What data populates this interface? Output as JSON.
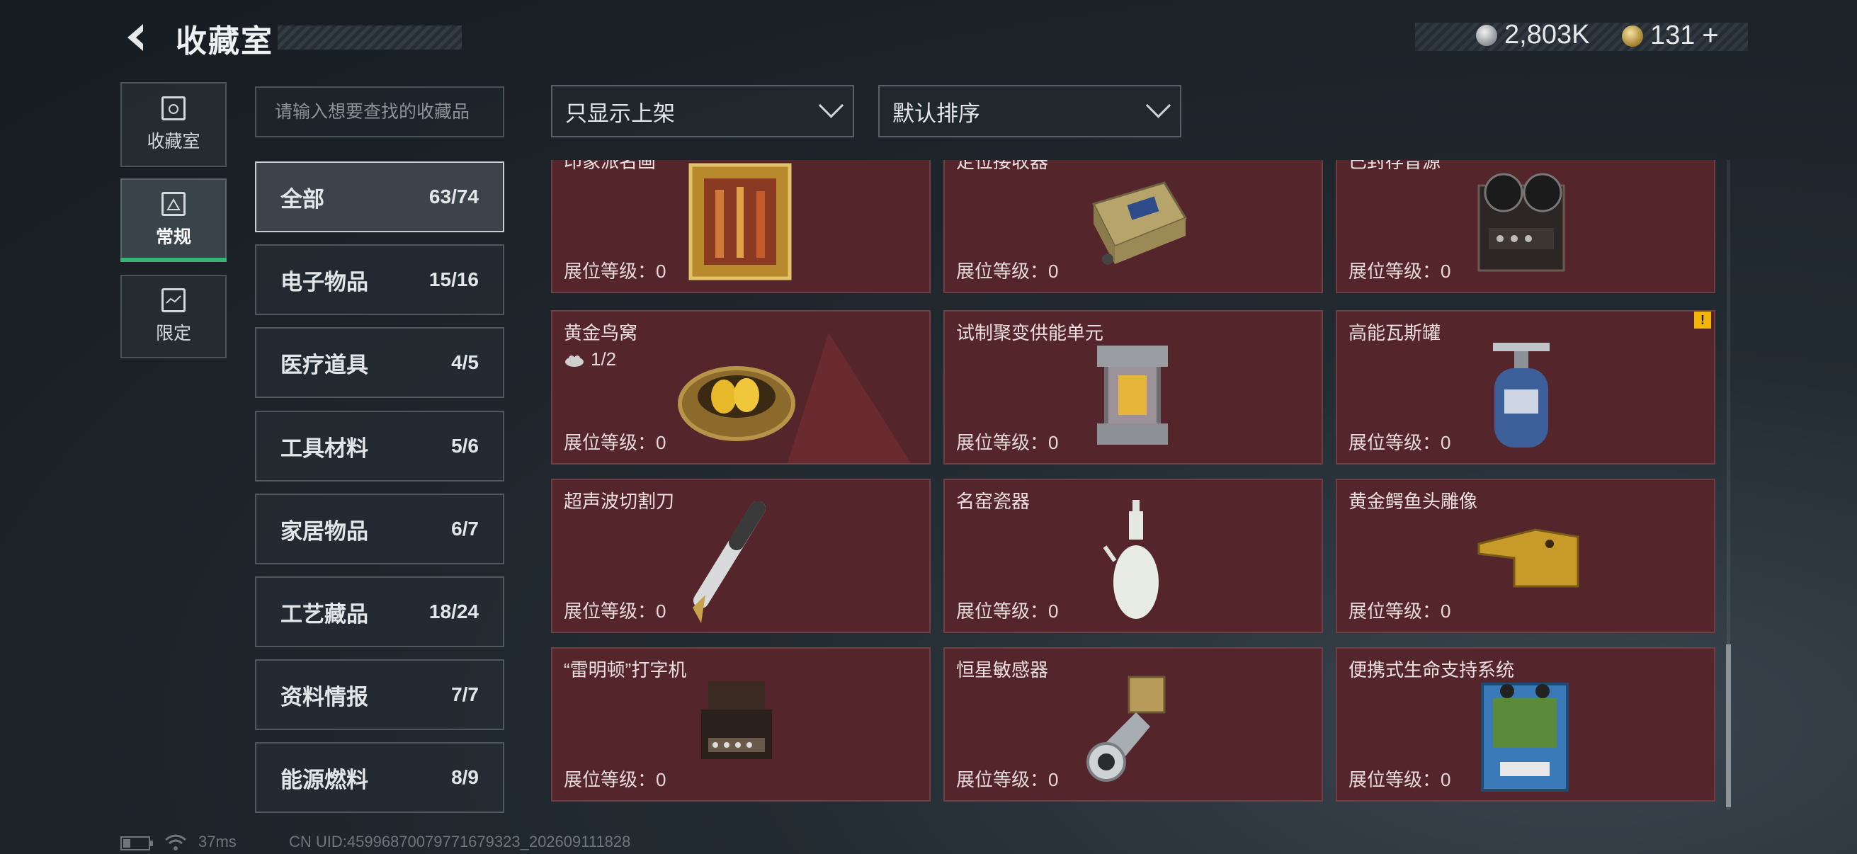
{
  "header": {
    "title": "收藏室"
  },
  "currency": {
    "silver": "2,803K",
    "gold": "131",
    "plus": "+"
  },
  "left_nav": [
    {
      "label": "收藏室",
      "icon": "trophy-icon"
    },
    {
      "label": "常规",
      "icon": "image-frame-icon",
      "active": true
    },
    {
      "label": "限定",
      "icon": "map-icon"
    }
  ],
  "search": {
    "placeholder": "请输入想要查找的收藏品"
  },
  "filters": {
    "display": "只显示上架",
    "sort": "默认排序"
  },
  "categories": [
    {
      "name": "全部",
      "count": "63/74",
      "active": true
    },
    {
      "name": "电子物品",
      "count": "15/16"
    },
    {
      "name": "医疗道具",
      "count": "4/5"
    },
    {
      "name": "工具材料",
      "count": "5/6"
    },
    {
      "name": "家居物品",
      "count": "6/7"
    },
    {
      "name": "工艺藏品",
      "count": "18/24"
    },
    {
      "name": "资料情报",
      "count": "7/7"
    },
    {
      "name": "能源燃料",
      "count": "8/9"
    }
  ],
  "level_label": "展位等级：",
  "items": [
    {
      "name": "印象派名画",
      "level": "0",
      "icon": "painting-icon"
    },
    {
      "name": "定位接收器",
      "level": "0",
      "icon": "receiver-icon"
    },
    {
      "name": "已封存音源",
      "level": "0",
      "icon": "tape-recorder-icon"
    },
    {
      "name": "黄金鸟窝",
      "level": "0",
      "icon": "golden-nest-icon",
      "progress": "1/2"
    },
    {
      "name": "试制聚变供能单元",
      "level": "0",
      "icon": "fusion-cell-icon"
    },
    {
      "name": "高能瓦斯罐",
      "level": "0",
      "icon": "gas-canister-icon",
      "warning": "!"
    },
    {
      "name": "超声波切割刀",
      "level": "0",
      "icon": "cutter-icon"
    },
    {
      "name": "名窑瓷器",
      "level": "0",
      "icon": "porcelain-vase-icon"
    },
    {
      "name": "黄金鳄鱼头雕像",
      "level": "0",
      "icon": "crocodile-statue-icon"
    },
    {
      "name": "“雷明顿”打字机",
      "level": "0",
      "icon": "typewriter-icon"
    },
    {
      "name": "恒星敏感器",
      "level": "0",
      "icon": "star-sensor-icon"
    },
    {
      "name": "便携式生命支持系统",
      "level": "0",
      "icon": "life-support-icon"
    }
  ],
  "footer": {
    "ping": "37ms",
    "uid": "CN UID:45996870079771679323_202609111828"
  }
}
